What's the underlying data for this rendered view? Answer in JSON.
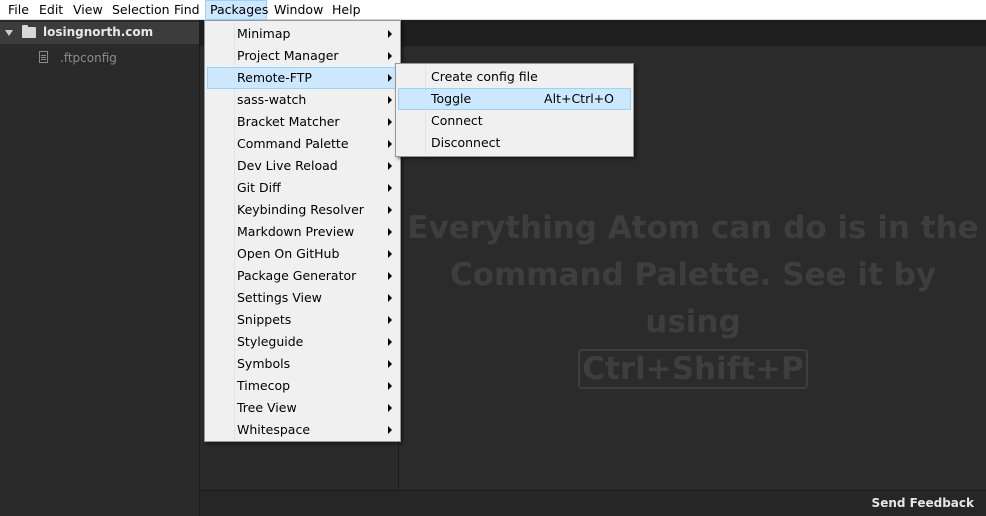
{
  "menubar": {
    "items": [
      "File",
      "Edit",
      "View",
      "Selection",
      "Find",
      "Packages",
      "Window",
      "Help"
    ],
    "active": "Packages"
  },
  "tree": {
    "root": "losingnorth.com",
    "files": [
      ".ftpconfig"
    ]
  },
  "packages_menu": {
    "items": [
      "Minimap",
      "Project Manager",
      "Remote-FTP",
      "sass-watch",
      "Bracket Matcher",
      "Command Palette",
      "Dev Live Reload",
      "Git Diff",
      "Keybinding Resolver",
      "Markdown Preview",
      "Open On GitHub",
      "Package Generator",
      "Settings View",
      "Snippets",
      "Styleguide",
      "Symbols",
      "Timecop",
      "Tree View",
      "Whitespace"
    ],
    "highlighted": "Remote-FTP"
  },
  "remote_ftp_menu": {
    "items": [
      {
        "label": "Create config file",
        "shortcut": ""
      },
      {
        "label": "Toggle",
        "shortcut": "Alt+Ctrl+O"
      },
      {
        "label": "Connect",
        "shortcut": ""
      },
      {
        "label": "Disconnect",
        "shortcut": ""
      }
    ],
    "highlighted": "Toggle"
  },
  "welcome": {
    "line1": "Everything Atom can do is in the",
    "line2": "Command Palette. See it by using",
    "shortcut": "Ctrl+Shift+P"
  },
  "statusbar": {
    "feedback": "Send Feedback"
  },
  "colors": {
    "menu_highlight": "#cce8ff",
    "menu_highlight_border": "#99d1ff",
    "menu_background": "#f0f0f0",
    "editor_background": "#2b2b2b"
  }
}
